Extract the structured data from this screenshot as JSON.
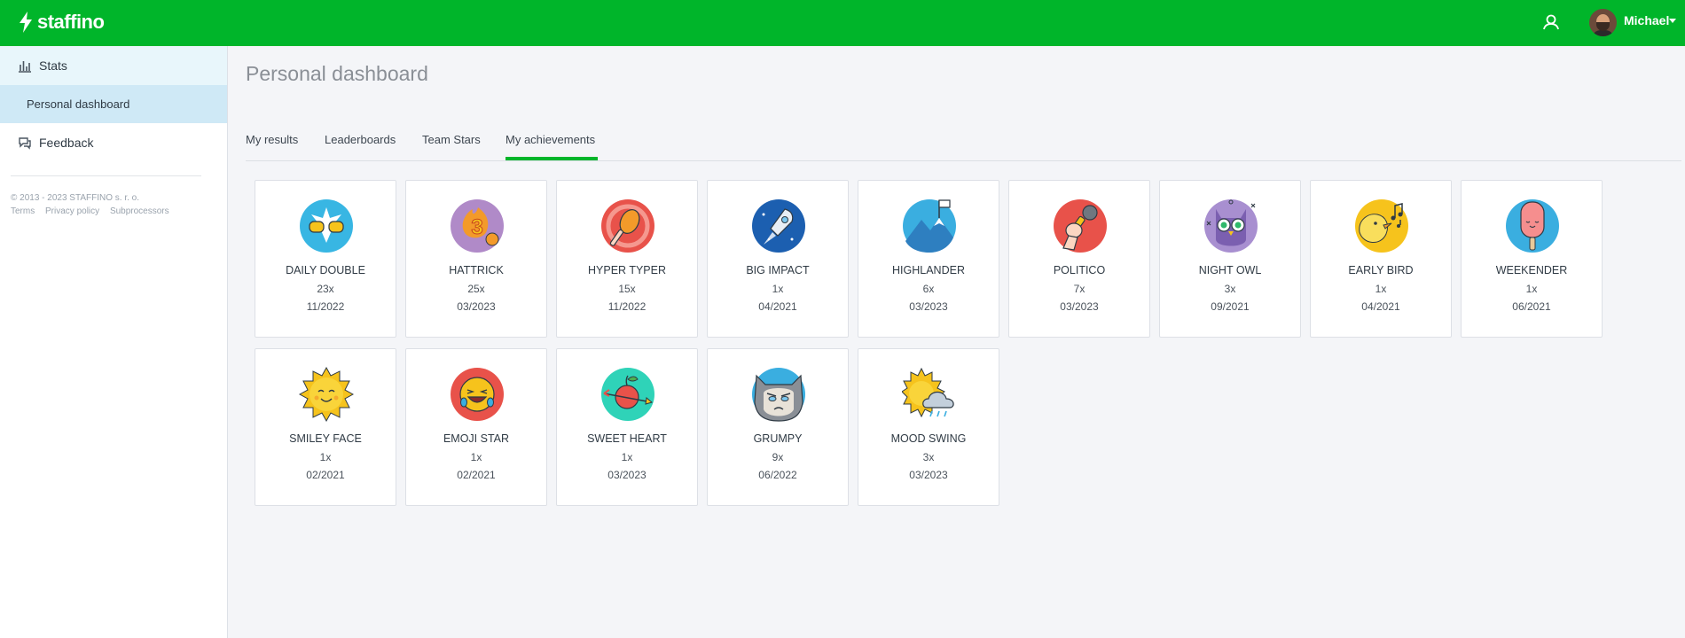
{
  "app": {
    "brand": "staffino",
    "user_name": "Michael"
  },
  "sidebar": {
    "stats_label": "Stats",
    "personal_label": "Personal dashboard",
    "feedback_label": "Feedback",
    "copyright": "© 2013 - 2023 STAFFINO s. r. o.",
    "links": [
      "Terms",
      "Privacy policy",
      "Subprocessors"
    ]
  },
  "page": {
    "title": "Personal dashboard",
    "tabs": [
      "My results",
      "Leaderboards",
      "Team Stars",
      "My achievements"
    ],
    "active_tab": "My achievements"
  },
  "achievements": [
    {
      "name": "DAILY DOUBLE",
      "count": "23x",
      "date": "11/2022",
      "icon": "fist-bump-icon"
    },
    {
      "name": "HATTRICK",
      "count": "25x",
      "date": "03/2023",
      "icon": "number-three-fire-icon"
    },
    {
      "name": "HYPER TYPER",
      "count": "15x",
      "date": "11/2022",
      "icon": "typing-hand-icon"
    },
    {
      "name": "BIG IMPACT",
      "count": "1x",
      "date": "04/2021",
      "icon": "rocket-icon"
    },
    {
      "name": "HIGHLANDER",
      "count": "6x",
      "date": "03/2023",
      "icon": "mountain-flag-icon"
    },
    {
      "name": "POLITICO",
      "count": "7x",
      "date": "03/2023",
      "icon": "microphone-hand-icon"
    },
    {
      "name": "NIGHT OWL",
      "count": "3x",
      "date": "09/2021",
      "icon": "owl-icon"
    },
    {
      "name": "EARLY BIRD",
      "count": "1x",
      "date": "04/2021",
      "icon": "singing-bird-icon"
    },
    {
      "name": "WEEKENDER",
      "count": "1x",
      "date": "06/2021",
      "icon": "ice-cream-icon"
    },
    {
      "name": "SMILEY FACE",
      "count": "1x",
      "date": "02/2021",
      "icon": "smiling-sun-icon"
    },
    {
      "name": "EMOJI STAR",
      "count": "1x",
      "date": "02/2021",
      "icon": "laughing-emoji-icon"
    },
    {
      "name": "SWEET HEART",
      "count": "1x",
      "date": "03/2023",
      "icon": "apple-arrow-icon"
    },
    {
      "name": "GRUMPY",
      "count": "9x",
      "date": "06/2022",
      "icon": "grumpy-cat-icon"
    },
    {
      "name": "MOOD SWING",
      "count": "3x",
      "date": "03/2023",
      "icon": "sun-cloud-rain-icon"
    }
  ]
}
